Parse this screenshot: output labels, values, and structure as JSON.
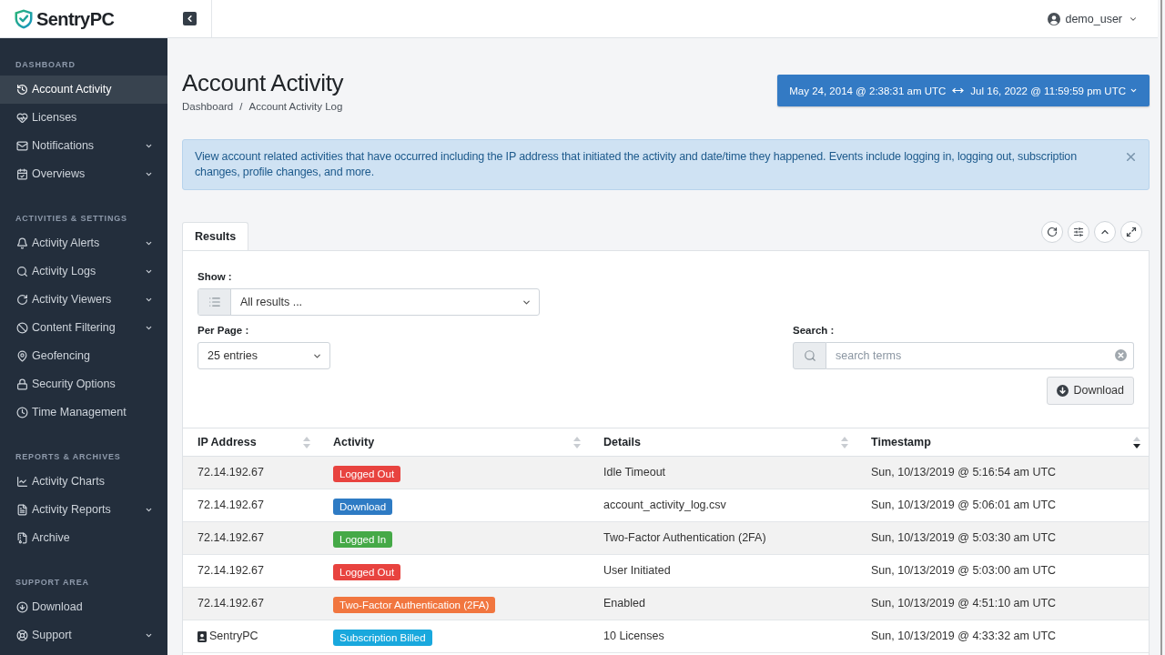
{
  "sidebar": {
    "logo": {
      "text": "SentryPC"
    },
    "sections": [
      {
        "title": "DASHBOARD",
        "items": [
          {
            "label": "Account Activity",
            "selected": true,
            "submenu": false
          },
          {
            "label": "Licenses",
            "selected": false,
            "submenu": false
          },
          {
            "label": "Notifications",
            "selected": false,
            "submenu": true
          },
          {
            "label": "Overviews",
            "selected": false,
            "submenu": true
          }
        ]
      },
      {
        "title": "ACTIVITIES & SETTINGS",
        "items": [
          {
            "label": "Activity Alerts",
            "selected": false,
            "submenu": true
          },
          {
            "label": "Activity Logs",
            "selected": false,
            "submenu": true
          },
          {
            "label": "Activity Viewers",
            "selected": false,
            "submenu": true
          },
          {
            "label": "Content Filtering",
            "selected": false,
            "submenu": true
          },
          {
            "label": "Geofencing",
            "selected": false,
            "submenu": false
          },
          {
            "label": "Security Options",
            "selected": false,
            "submenu": false
          },
          {
            "label": "Time Management",
            "selected": false,
            "submenu": false
          }
        ]
      },
      {
        "title": "REPORTS & ARCHIVES",
        "items": [
          {
            "label": "Activity Charts",
            "selected": false,
            "submenu": false
          },
          {
            "label": "Activity Reports",
            "selected": false,
            "submenu": true
          },
          {
            "label": "Archive",
            "selected": false,
            "submenu": false
          }
        ]
      },
      {
        "title": "SUPPORT AREA",
        "items": [
          {
            "label": "Download",
            "selected": false,
            "submenu": false
          },
          {
            "label": "Support",
            "selected": false,
            "submenu": true
          }
        ]
      }
    ]
  },
  "header": {
    "user": "demo_user"
  },
  "page": {
    "title": "Account Activity",
    "breadcrumb": {
      "items": [
        "Dashboard",
        "Account Activity Log"
      ],
      "separator": "/"
    },
    "date_range": {
      "start": "May 24, 2014 @ 2:38:31 am UTC",
      "end": "Jul 16, 2022 @ 11:59:59 pm UTC"
    }
  },
  "alert": {
    "text": "View account related activities that have occurred including the IP address that initiated the activity and date/time they happened. Events include logging in, logging out, subscription changes, profile changes, and more."
  },
  "results": {
    "tabs": [
      {
        "label": "Results",
        "selected": true
      }
    ],
    "show": {
      "label": "Show :",
      "value": "All results ..."
    },
    "per_page": {
      "label": "Per Page :",
      "value": "25 entries"
    },
    "search": {
      "label": "Search :",
      "placeholder": "search terms"
    },
    "download": {
      "label": "Download"
    }
  },
  "table": {
    "columns": [
      {
        "label": "IP Address",
        "sorted_descending": false
      },
      {
        "label": "Activity",
        "sorted_descending": false
      },
      {
        "label": "Details",
        "sorted_descending": false
      },
      {
        "label": "Timestamp",
        "sorted_descending": true
      }
    ],
    "rows": [
      {
        "kind": "address",
        "ip": "72.14.192.67",
        "activity": {
          "label": "Logged Out",
          "color": "#e8433f"
        },
        "details": "Idle Timeout",
        "timestamp": "Sun, 10/13/2019 @ 5:16:54 am UTC"
      },
      {
        "kind": "address",
        "ip": "72.14.192.67",
        "activity": {
          "label": "Download",
          "color": "#2e7bc4"
        },
        "details": "account_activity_log.csv",
        "timestamp": "Sun, 10/13/2019 @ 5:06:01 am UTC"
      },
      {
        "kind": "address",
        "ip": "72.14.192.67",
        "activity": {
          "label": "Logged In",
          "color": "#45a947"
        },
        "details": "Two-Factor Authentication (2FA)",
        "timestamp": "Sun, 10/13/2019 @ 5:03:30 am UTC"
      },
      {
        "kind": "address",
        "ip": "72.14.192.67",
        "activity": {
          "label": "Logged Out",
          "color": "#e8433f"
        },
        "details": "User Initiated",
        "timestamp": "Sun, 10/13/2019 @ 5:03:00 am UTC"
      },
      {
        "kind": "address",
        "ip": "72.14.192.67",
        "activity": {
          "label": "Two-Factor Authentication (2FA)",
          "color": "#f1763f"
        },
        "details": "Enabled",
        "timestamp": "Sun, 10/13/2019 @ 4:51:10 am UTC"
      },
      {
        "kind": "account",
        "ip": "SentryPC",
        "activity": {
          "label": "Subscription Billed",
          "color": "#19a8dd"
        },
        "details": "10 Licenses",
        "timestamp": "Sun, 10/13/2019 @ 4:33:32 am UTC"
      }
    ]
  }
}
